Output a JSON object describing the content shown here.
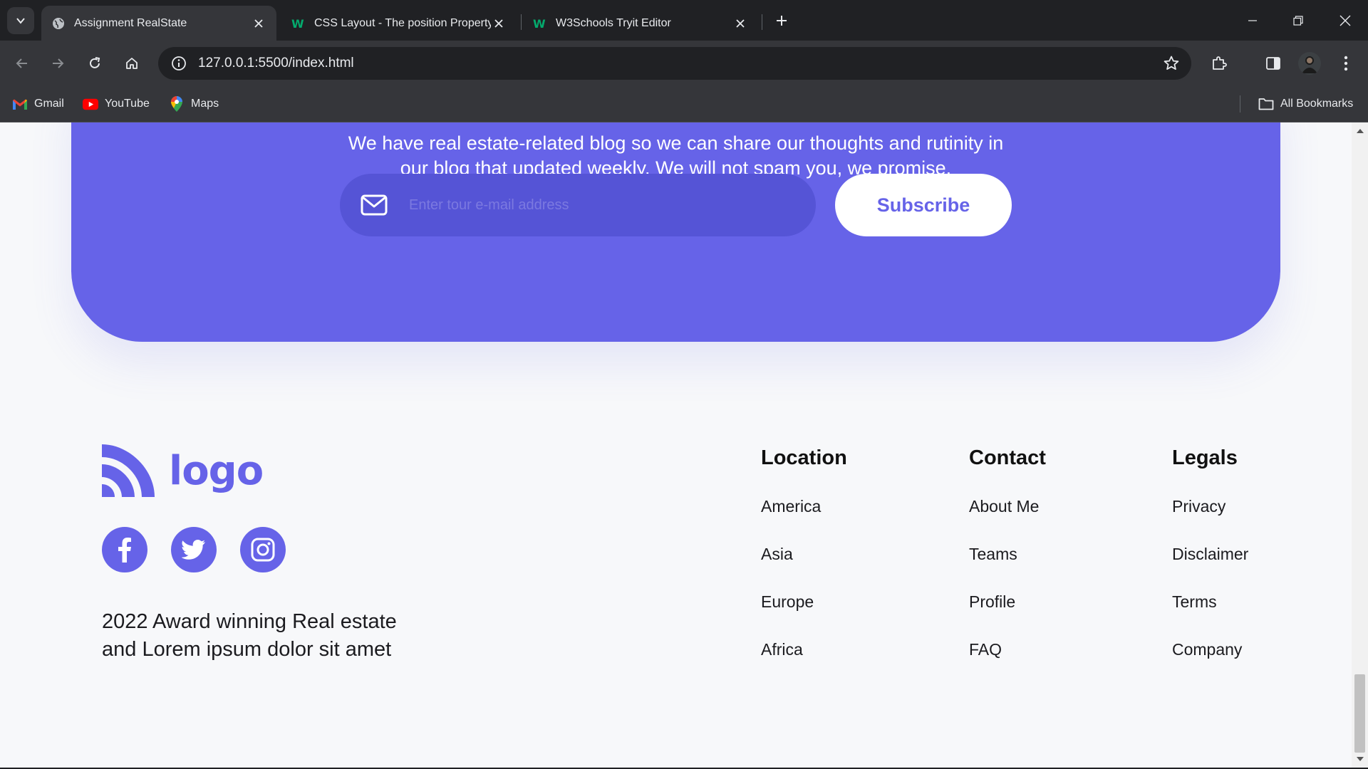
{
  "browser": {
    "tabs": [
      {
        "title": "Assignment RealState",
        "active": true
      },
      {
        "title": "CSS Layout - The position Property",
        "active": false
      },
      {
        "title": "W3Schools Tryit Editor",
        "active": false
      }
    ],
    "url": "127.0.0.1:5500/index.html",
    "bookmarks": [
      {
        "label": "Gmail",
        "icon": "gmail-icon"
      },
      {
        "label": "YouTube",
        "icon": "youtube-icon"
      },
      {
        "label": "Maps",
        "icon": "maps-icon"
      }
    ],
    "all_bookmarks": "All Bookmarks"
  },
  "newsletter": {
    "line1": "We have real estate-related blog so we can share our thoughts and rutinity in",
    "line2": "our blog that updated weekly. We will not spam you, we promise.",
    "email_placeholder": "Enter tour e-mail address",
    "subscribe_label": "Subscribe"
  },
  "footer": {
    "logo_text": "logo",
    "tagline_line1": "2022 Award winning Real estate",
    "tagline_line2": "and Lorem ipsum dolor sit amet",
    "columns": [
      {
        "heading": "Location",
        "links": [
          "America",
          "Asia",
          "Europe",
          "Africa"
        ]
      },
      {
        "heading": "Contact",
        "links": [
          "About Me",
          "Teams",
          "Profile",
          "FAQ"
        ]
      },
      {
        "heading": "Legals",
        "links": [
          "Privacy",
          "Disclaimer",
          "Terms",
          "Company"
        ]
      }
    ]
  },
  "colors": {
    "accent": "#6663e8",
    "page_bg": "#f7f8fa",
    "chrome_dark": "#202124",
    "chrome_mid": "#35363a"
  }
}
